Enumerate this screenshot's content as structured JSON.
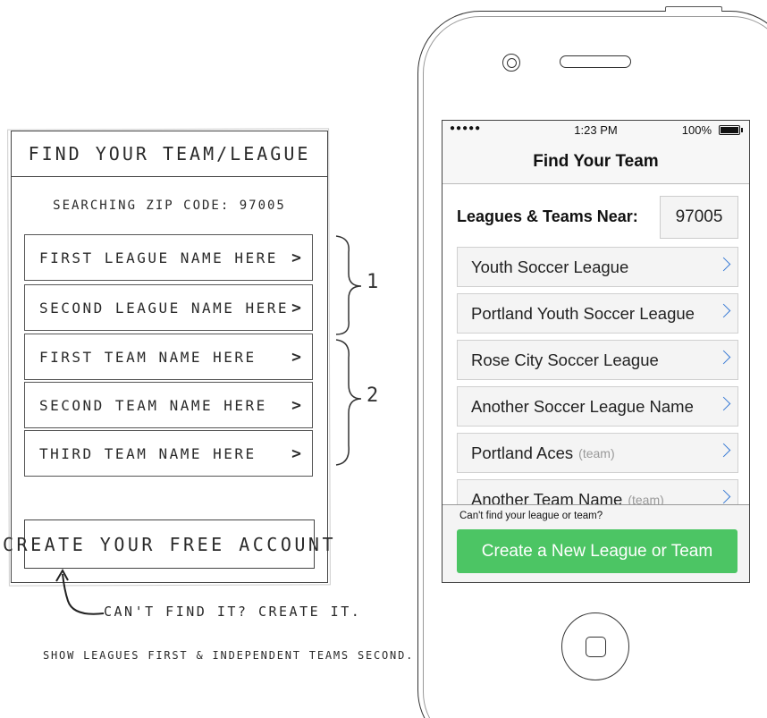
{
  "sketch": {
    "header": "FIND YOUR TEAM/LEAGUE",
    "zip_line": "SEARCHING ZIP CODE: 97005",
    "rows": [
      {
        "label": "FIRST LEAGUE NAME HERE",
        "chevron": ">"
      },
      {
        "label": "SECOND LEAGUE NAME HERE",
        "chevron": ">"
      },
      {
        "label": "FIRST TEAM NAME HERE",
        "chevron": ">"
      },
      {
        "label": "SECOND TEAM NAME HERE",
        "chevron": ">"
      },
      {
        "label": "THIRD TEAM NAME HERE",
        "chevron": ">"
      }
    ],
    "cta": "CREATE YOUR FREE ACCOUNT",
    "arrow_note": "CAN'T FIND IT? CREATE IT.",
    "footer_note": "SHOW LEAGUES FIRST & INDEPENDENT TEAMS SECOND.",
    "brace_labels": [
      "1",
      "2"
    ]
  },
  "phone": {
    "status": {
      "dots": "●●●●●",
      "time": "1:23 PM",
      "battery": "100%"
    },
    "nav_title": "Find Your Team",
    "near_label": "Leagues & Teams Near:",
    "zip_value": "97005",
    "items": [
      {
        "label": "Youth Soccer League",
        "sub": ""
      },
      {
        "label": "Portland Youth Soccer League",
        "sub": ""
      },
      {
        "label": "Rose City Soccer League",
        "sub": ""
      },
      {
        "label": "Another Soccer League Name",
        "sub": ""
      },
      {
        "label": "Portland Aces",
        "sub": "(team)"
      },
      {
        "label": "Another Team Name",
        "sub": "(team)"
      }
    ],
    "cant_find": "Can't find your league or team?",
    "create_button": "Create a New League or Team"
  },
  "colors": {
    "accent_green": "#4cc564",
    "chevron_blue": "#3a7bd5"
  }
}
